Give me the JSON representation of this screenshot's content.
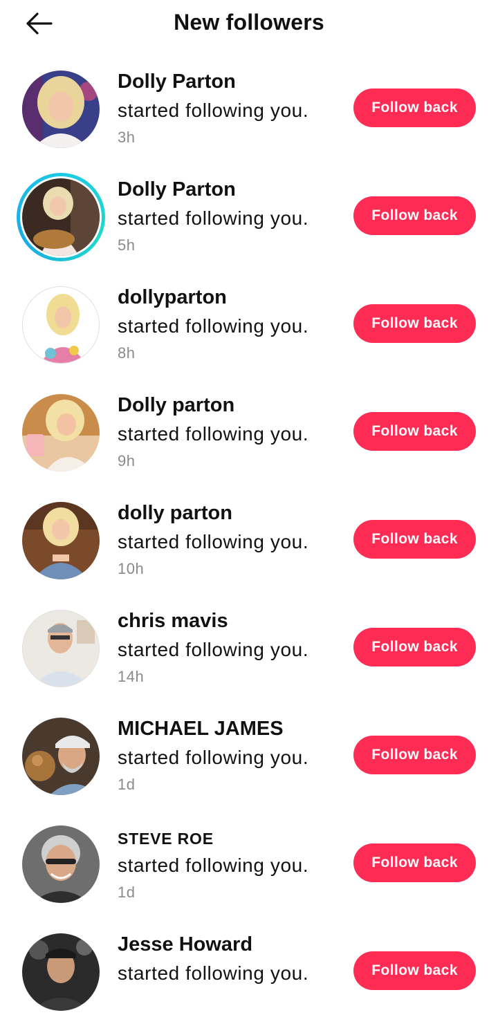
{
  "header": {
    "title": "New followers",
    "back_icon": "arrow-left-icon"
  },
  "colors": {
    "accent": "#fe2c55",
    "story_ring": "#1ec9e6",
    "muted_text": "#8a8a8a"
  },
  "followers": [
    {
      "name": "Dolly Parton",
      "message": "started following you.",
      "time": "3h",
      "button": "Follow back"
    },
    {
      "name": "Dolly Parton",
      "message": "started following you.",
      "time": "5h",
      "button": "Follow back"
    },
    {
      "name": "dollyparton",
      "message": "started following you.",
      "time": "8h",
      "button": "Follow back"
    },
    {
      "name": "Dolly parton",
      "message": "started following you.",
      "time": "9h",
      "button": "Follow back"
    },
    {
      "name": "dolly parton",
      "message": "started following you.",
      "time": "10h",
      "button": "Follow back"
    },
    {
      "name": "chris mavis",
      "message": "started following you.",
      "time": "14h",
      "button": "Follow back"
    },
    {
      "name": "MICHAEL JAMES",
      "message": "started following you.",
      "time": "1d",
      "button": "Follow back"
    },
    {
      "name": "STEVE ROE",
      "message": "started following you.",
      "time": "1d",
      "button": "Follow back"
    },
    {
      "name": "Jesse Howard",
      "message": "started following you.",
      "time": "",
      "button": "Follow back"
    }
  ]
}
